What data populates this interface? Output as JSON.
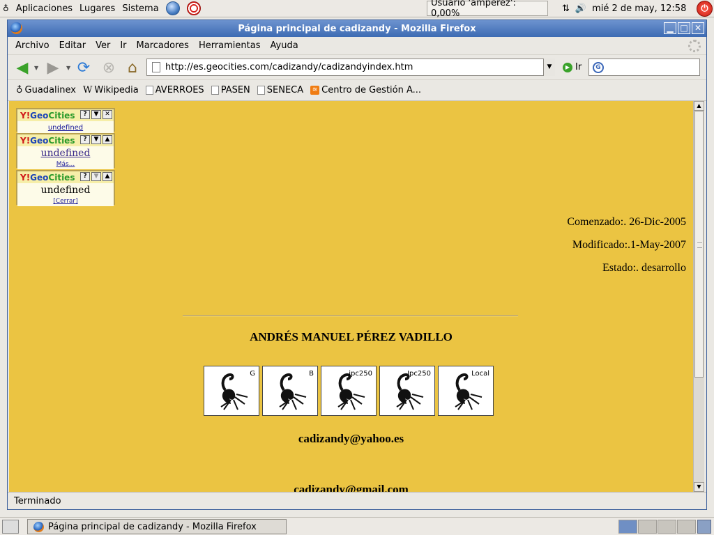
{
  "desktop": {
    "menus": [
      "Aplicaciones",
      "Lugares",
      "Sistema"
    ],
    "user_status": "Usuario 'amperez': 0,00%",
    "clock": "mié   2 de may, 12:58"
  },
  "window": {
    "title": "Página principal de cadizandy - Mozilla Firefox",
    "menu": [
      "Archivo",
      "Editar",
      "Ver",
      "Ir",
      "Marcadores",
      "Herramientas",
      "Ayuda"
    ],
    "url": "http://es.geocities.com/cadizandy/cadizandyindex.htm",
    "go_label": "Ir",
    "search_placeholder": "",
    "bookmarks": [
      "Guadalinex",
      "Wikipedia",
      "AVERROES",
      "PASEN",
      "SENECA",
      "Centro de Gestión A..."
    ],
    "status": "Terminado"
  },
  "page": {
    "geocities_widgets": [
      {
        "logo": "GeoCities",
        "body": "undefined"
      },
      {
        "logo": "GeoCities",
        "body": "undefined",
        "link": "Más..."
      },
      {
        "logo": "GeoCities",
        "body": "undefined",
        "link": "[Cerrar]"
      }
    ],
    "started": "Comenzado:. 26-Dic-2005",
    "modified": "Modificado:.1-May-2007",
    "state": "Estado:. desarrollo",
    "name": "ANDRÉS MANUEL PÉREZ VADILLO",
    "badges": [
      "G",
      "B",
      "ipc250",
      "Ipc250",
      "Local"
    ],
    "email1": "cadizandy@yahoo.es",
    "email2": "cadizandy@gmail.com"
  },
  "taskbar": {
    "task_label": "Página principal de cadizandy - Mozilla Firefox"
  },
  "colors": {
    "page_background": "#ebc442",
    "titlebar": "#4a76bd"
  }
}
